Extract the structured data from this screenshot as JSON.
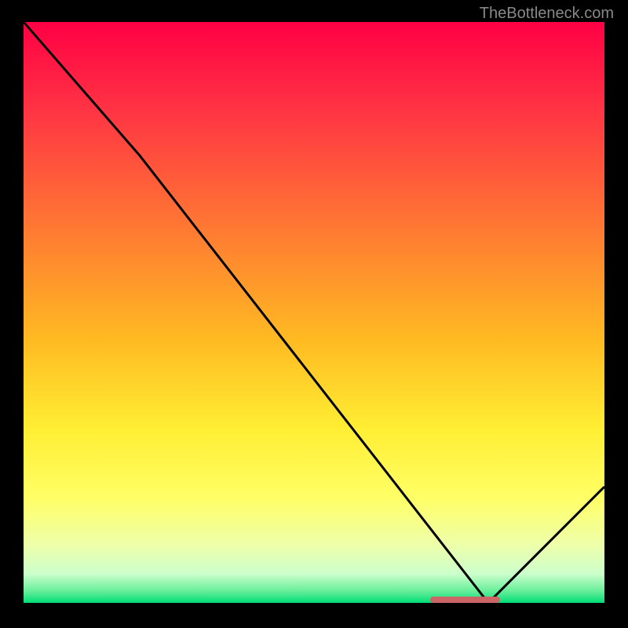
{
  "watermark": "TheBottleneck.com",
  "chart_data": {
    "type": "line",
    "title": "",
    "xlabel": "",
    "ylabel": "",
    "xlim": [
      0,
      100
    ],
    "ylim": [
      0,
      100
    ],
    "x": [
      0,
      20,
      80,
      100
    ],
    "values": [
      100,
      77,
      0,
      20
    ],
    "gradient_stops": [
      {
        "offset": 0,
        "color": "#ff0044"
      },
      {
        "offset": 0.15,
        "color": "#ff3344"
      },
      {
        "offset": 0.35,
        "color": "#ff7733"
      },
      {
        "offset": 0.55,
        "color": "#ffbb22"
      },
      {
        "offset": 0.7,
        "color": "#ffee33"
      },
      {
        "offset": 0.82,
        "color": "#ffff66"
      },
      {
        "offset": 0.9,
        "color": "#eeffaa"
      },
      {
        "offset": 0.95,
        "color": "#ccffcc"
      },
      {
        "offset": 0.98,
        "color": "#66ee99"
      },
      {
        "offset": 1.0,
        "color": "#00dd77"
      }
    ],
    "marker": {
      "x_start": 70,
      "x_end": 82,
      "y": 0
    }
  }
}
